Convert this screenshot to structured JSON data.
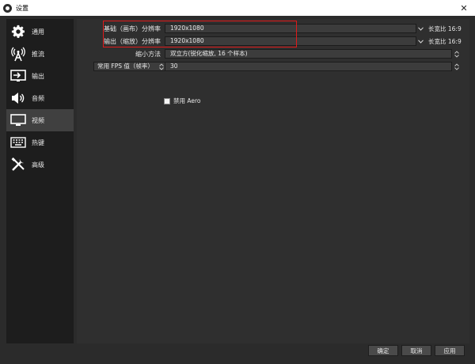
{
  "window": {
    "title": "设置",
    "close_glyph": "✕"
  },
  "sidebar": {
    "items": [
      {
        "label": "通用",
        "icon": "gear-icon"
      },
      {
        "label": "推流",
        "icon": "antenna-icon"
      },
      {
        "label": "输出",
        "icon": "output-icon"
      },
      {
        "label": "音频",
        "icon": "speaker-icon"
      },
      {
        "label": "视频",
        "icon": "monitor-icon",
        "active": true
      },
      {
        "label": "热键",
        "icon": "keyboard-icon"
      },
      {
        "label": "高级",
        "icon": "tools-icon"
      }
    ]
  },
  "video": {
    "base_resolution": {
      "label": "基础（画布）分辨率",
      "value": "1920x1080",
      "aspect": "长宽比 16:9"
    },
    "output_resolution": {
      "label": "输出（缩放）分辨率",
      "value": "1920x1080",
      "aspect": "长宽比 16:9"
    },
    "downscale_filter": {
      "label": "缩小方法",
      "value": "双立方(锐化缩放, 16 个样本)"
    },
    "fps": {
      "mode": "常用 FPS 值（帧率）",
      "value": "30"
    },
    "disable_aero": {
      "label": "禁用 Aero",
      "checked": false
    }
  },
  "buttons": {
    "ok": "确定",
    "cancel": "取消",
    "apply": "应用"
  },
  "colors": {
    "highlight_border": "#e01a1a",
    "active_nav": "#404040"
  }
}
